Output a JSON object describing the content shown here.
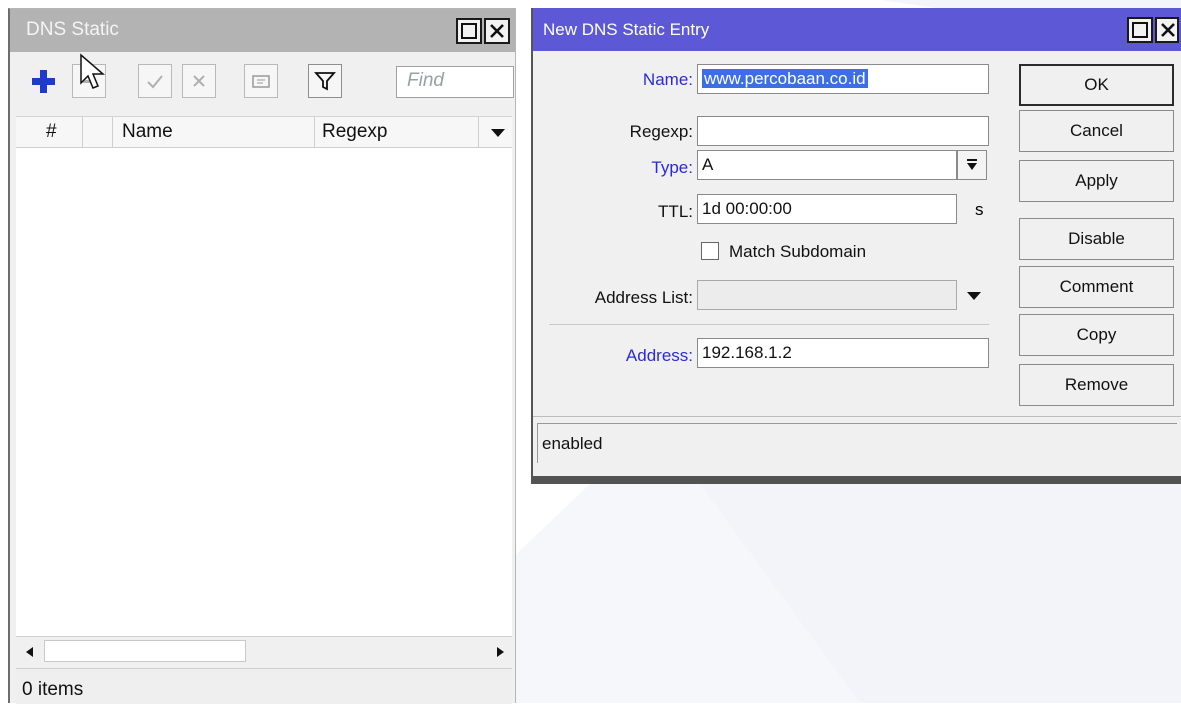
{
  "background": {
    "accent": "#eef1f7"
  },
  "dns_static_window": {
    "title": "DNS Static",
    "controls": {
      "maximize": "□",
      "close": "✕"
    },
    "toolbar": {
      "add_icon": "plus-icon",
      "remove_icon": "minus-icon",
      "enable_icon": "check-icon",
      "disable_icon": "cross-icon",
      "comment_icon": "note-icon",
      "filter_icon": "funnel-icon",
      "find_placeholder": "Find"
    },
    "columns": [
      "#",
      "",
      "Name",
      "Regexp"
    ],
    "status": "0 items"
  },
  "new_entry_window": {
    "title": "New DNS Static Entry",
    "fields": {
      "name_label": "Name:",
      "name_value": "www.percobaan.co.id",
      "regexp_label": "Regexp:",
      "regexp_value": "",
      "type_label": "Type:",
      "type_value": "A",
      "ttl_label": "TTL:",
      "ttl_value": "1d 00:00:00",
      "ttl_unit": "s",
      "match_subdomain_label": "Match Subdomain",
      "match_subdomain_checked": false,
      "address_list_label": "Address List:",
      "address_list_value": "",
      "address_label": "Address:",
      "address_value": "192.168.1.2"
    },
    "buttons": {
      "ok": "OK",
      "cancel": "Cancel",
      "apply": "Apply",
      "disable": "Disable",
      "comment": "Comment",
      "copy": "Copy",
      "remove": "Remove"
    },
    "status": "enabled"
  }
}
